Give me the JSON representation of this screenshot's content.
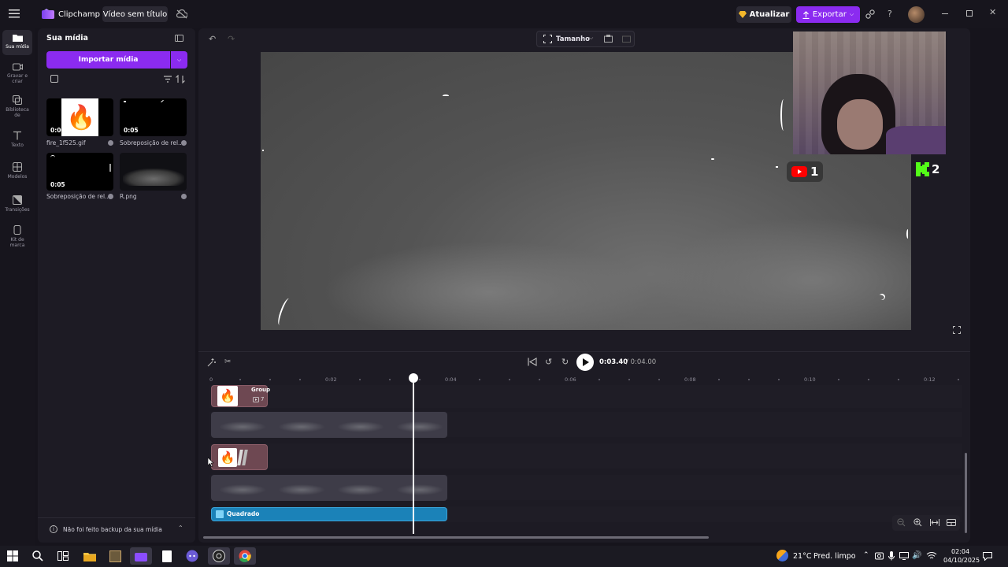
{
  "app": {
    "name": "Clipchamp",
    "video_title": "Vídeo sem título",
    "upgrade_label": "Atualizar",
    "export_label": "Exportar"
  },
  "rail": [
    {
      "label": "Sua mídia"
    },
    {
      "label": "Gravar e criar"
    },
    {
      "label": "Biblioteca de conteúdo"
    },
    {
      "label": "Texto"
    },
    {
      "label": "Modelos"
    },
    {
      "label": "Transições"
    },
    {
      "label": "Kit de marca"
    }
  ],
  "media": {
    "title": "Sua mídia",
    "import_label": "Importar mídia",
    "items": [
      {
        "name": "fire_1f525.gif",
        "duration": "0:00"
      },
      {
        "name": "Sobreposição de rel...",
        "duration": "0:05"
      },
      {
        "name": "Sobreposição de rel...",
        "duration": "0:05"
      },
      {
        "name": "R.png",
        "duration": ""
      }
    ],
    "backup_notice": "Não foi feito backup da sua mídia"
  },
  "preview": {
    "size_label": "Tamanho"
  },
  "webcam": {
    "youtube_count": "1",
    "kick_count": "2"
  },
  "player": {
    "current_time": "0:03.40",
    "total_time": "/ 0:04.00"
  },
  "ruler": {
    "labels": [
      "0",
      "0:02",
      "0:04",
      "0:06",
      "0:08",
      "0:10",
      "0:12"
    ]
  },
  "timeline": {
    "group_label": "Group",
    "group_count": "7",
    "text_clip_label": "Quadrado"
  },
  "taskbar": {
    "weather_temp": "21°C",
    "weather_desc": "Pred. limpo",
    "time": "02:04",
    "date": "04/10/2025"
  },
  "colors": {
    "accent": "#8b2bf0",
    "text_clip": "#1b82b8",
    "group_clip": "#6e4852",
    "playhead": "#ffffff"
  }
}
